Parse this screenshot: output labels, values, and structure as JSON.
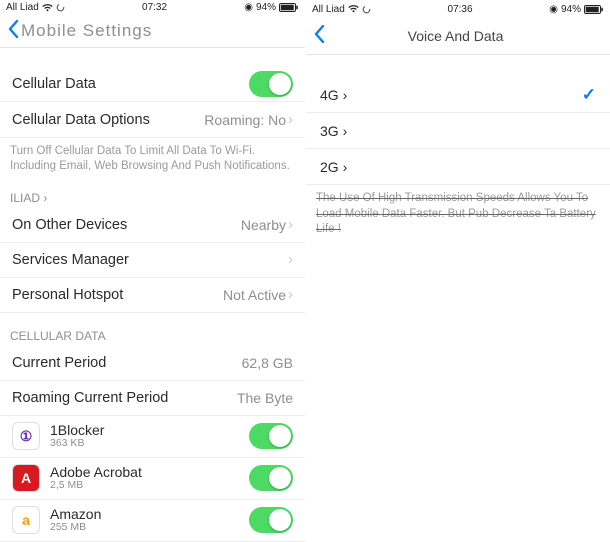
{
  "left": {
    "status": {
      "carrier": "All Liad",
      "time": "07:32",
      "battery": "94%"
    },
    "nav": {
      "back_label": "Mobile Settings"
    },
    "cellular_data": {
      "label": "Cellular Data"
    },
    "cellular_options": {
      "label": "Cellular Data Options",
      "value": "Roaming: No"
    },
    "footer1": "Turn Off Cellular Data To Limit All Data To Wi-Fi. Including Email, Web Browsing And Push Notifications.",
    "section_iliad": "ILIAD ›",
    "other_devices": {
      "label": "On Other Devices",
      "value": "Nearby"
    },
    "services_manager": {
      "label": "Services Manager"
    },
    "hotspot": {
      "label": "Personal Hotspot",
      "value": "Not Active"
    },
    "section_usage": "CELLULAR DATA",
    "current_period": {
      "label": "Current Period",
      "value": "62,8 GB"
    },
    "roaming_period": {
      "label": "Roaming Current Period",
      "value": "The Byte"
    },
    "apps": [
      {
        "name": "1Blocker",
        "size": "363 KB",
        "bg": "#fff",
        "txt": "①",
        "tc": "#6a2bb7"
      },
      {
        "name": "Adobe Acrobat",
        "size": "2,5 MB",
        "bg": "#d71920",
        "txt": "A",
        "tc": "#fff"
      },
      {
        "name": "Amazon",
        "size": "255 MB",
        "bg": "#fff",
        "txt": "a",
        "tc": "#ff9900"
      }
    ]
  },
  "right": {
    "status": {
      "carrier": "All Liad",
      "time": "07:36",
      "battery": "94%"
    },
    "nav": {
      "title": "Voice And Data"
    },
    "options": [
      {
        "label": "4G ›",
        "checked": true
      },
      {
        "label": "3G ›",
        "checked": false
      },
      {
        "label": "2G ›",
        "checked": false
      }
    ],
    "footer": "The Use Of High Transmission Speeds Allows You To Load Mobile Data Faster. But Pub Decrease Ta Battery Life !"
  }
}
